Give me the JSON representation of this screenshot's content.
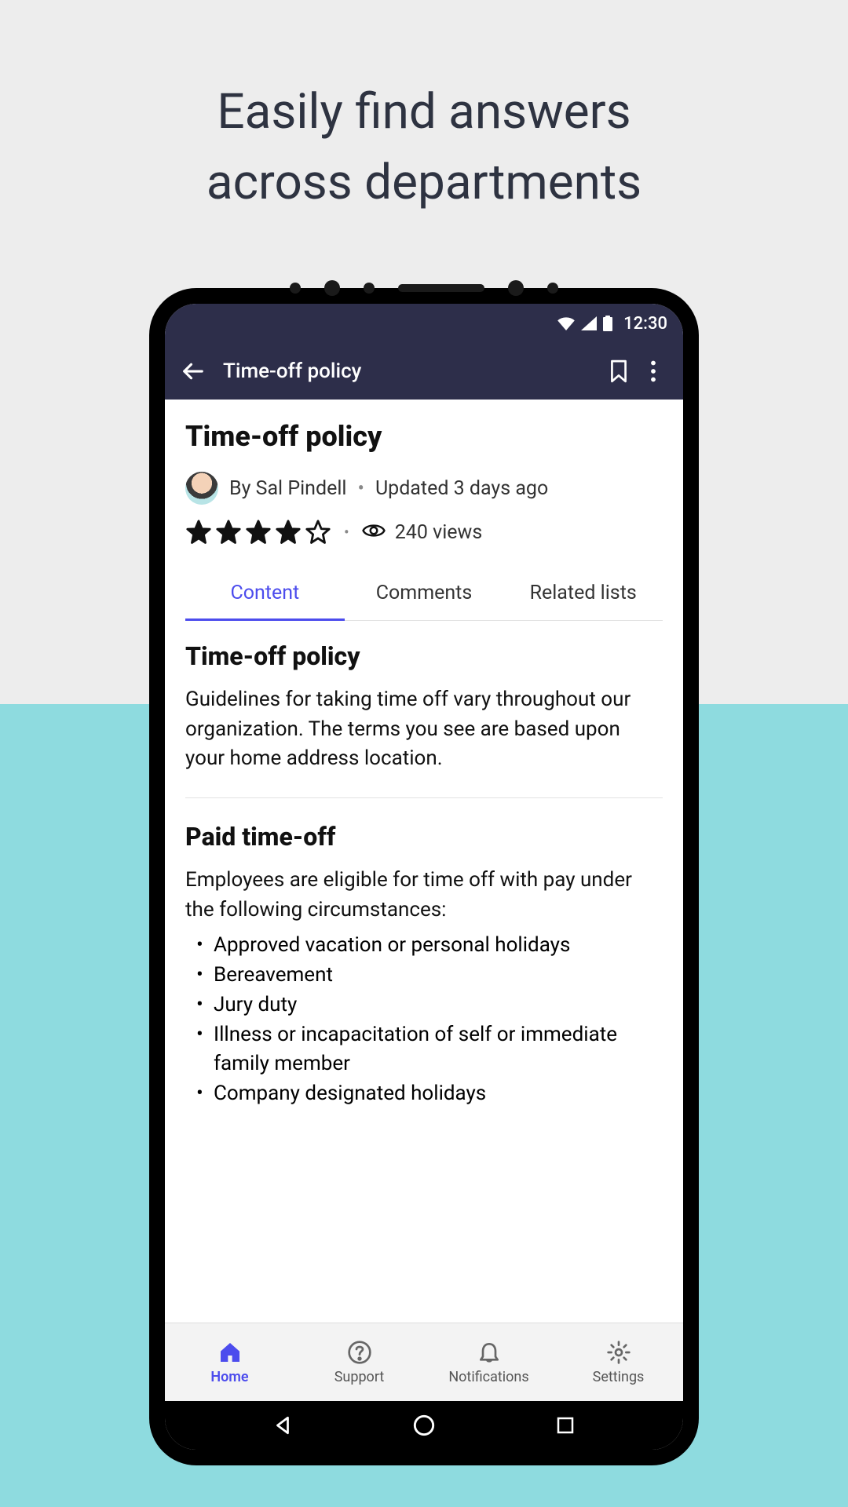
{
  "hero": {
    "line1": "Easily find answers",
    "line2": "across departments"
  },
  "status": {
    "time": "12:30"
  },
  "appbar": {
    "title": "Time-off policy"
  },
  "page": {
    "title": "Time-off policy",
    "author_prefix": "By ",
    "author": "Sal Pindell",
    "updated": "Updated 3 days ago",
    "rating": 4,
    "rating_max": 5,
    "views": "240 views"
  },
  "tabs": [
    {
      "label": "Content",
      "active": true
    },
    {
      "label": "Comments",
      "active": false
    },
    {
      "label": "Related lists",
      "active": false
    }
  ],
  "article": {
    "sections": [
      {
        "heading": "Time-off policy",
        "body": "Guidelines for taking time off vary throughout our organization. The terms you see are based upon your home address location."
      },
      {
        "heading": "Paid time-off",
        "body": "Employees are eligible for time off with pay under the following circumstances:",
        "bullets": [
          "Approved vacation or personal holidays",
          "Bereavement",
          "Jury duty",
          "Illness or incapacitation of self or immediate family member",
          "Company designated holidays"
        ]
      }
    ]
  },
  "bottom_nav": [
    {
      "label": "Home",
      "icon": "home-icon",
      "active": true
    },
    {
      "label": "Support",
      "icon": "help-icon",
      "active": false
    },
    {
      "label": "Notifications",
      "icon": "bell-icon",
      "active": false
    },
    {
      "label": "Settings",
      "icon": "gear-icon",
      "active": false
    }
  ],
  "colors": {
    "accent": "#4c4ced",
    "appbar_bg": "#2d2e4a"
  }
}
